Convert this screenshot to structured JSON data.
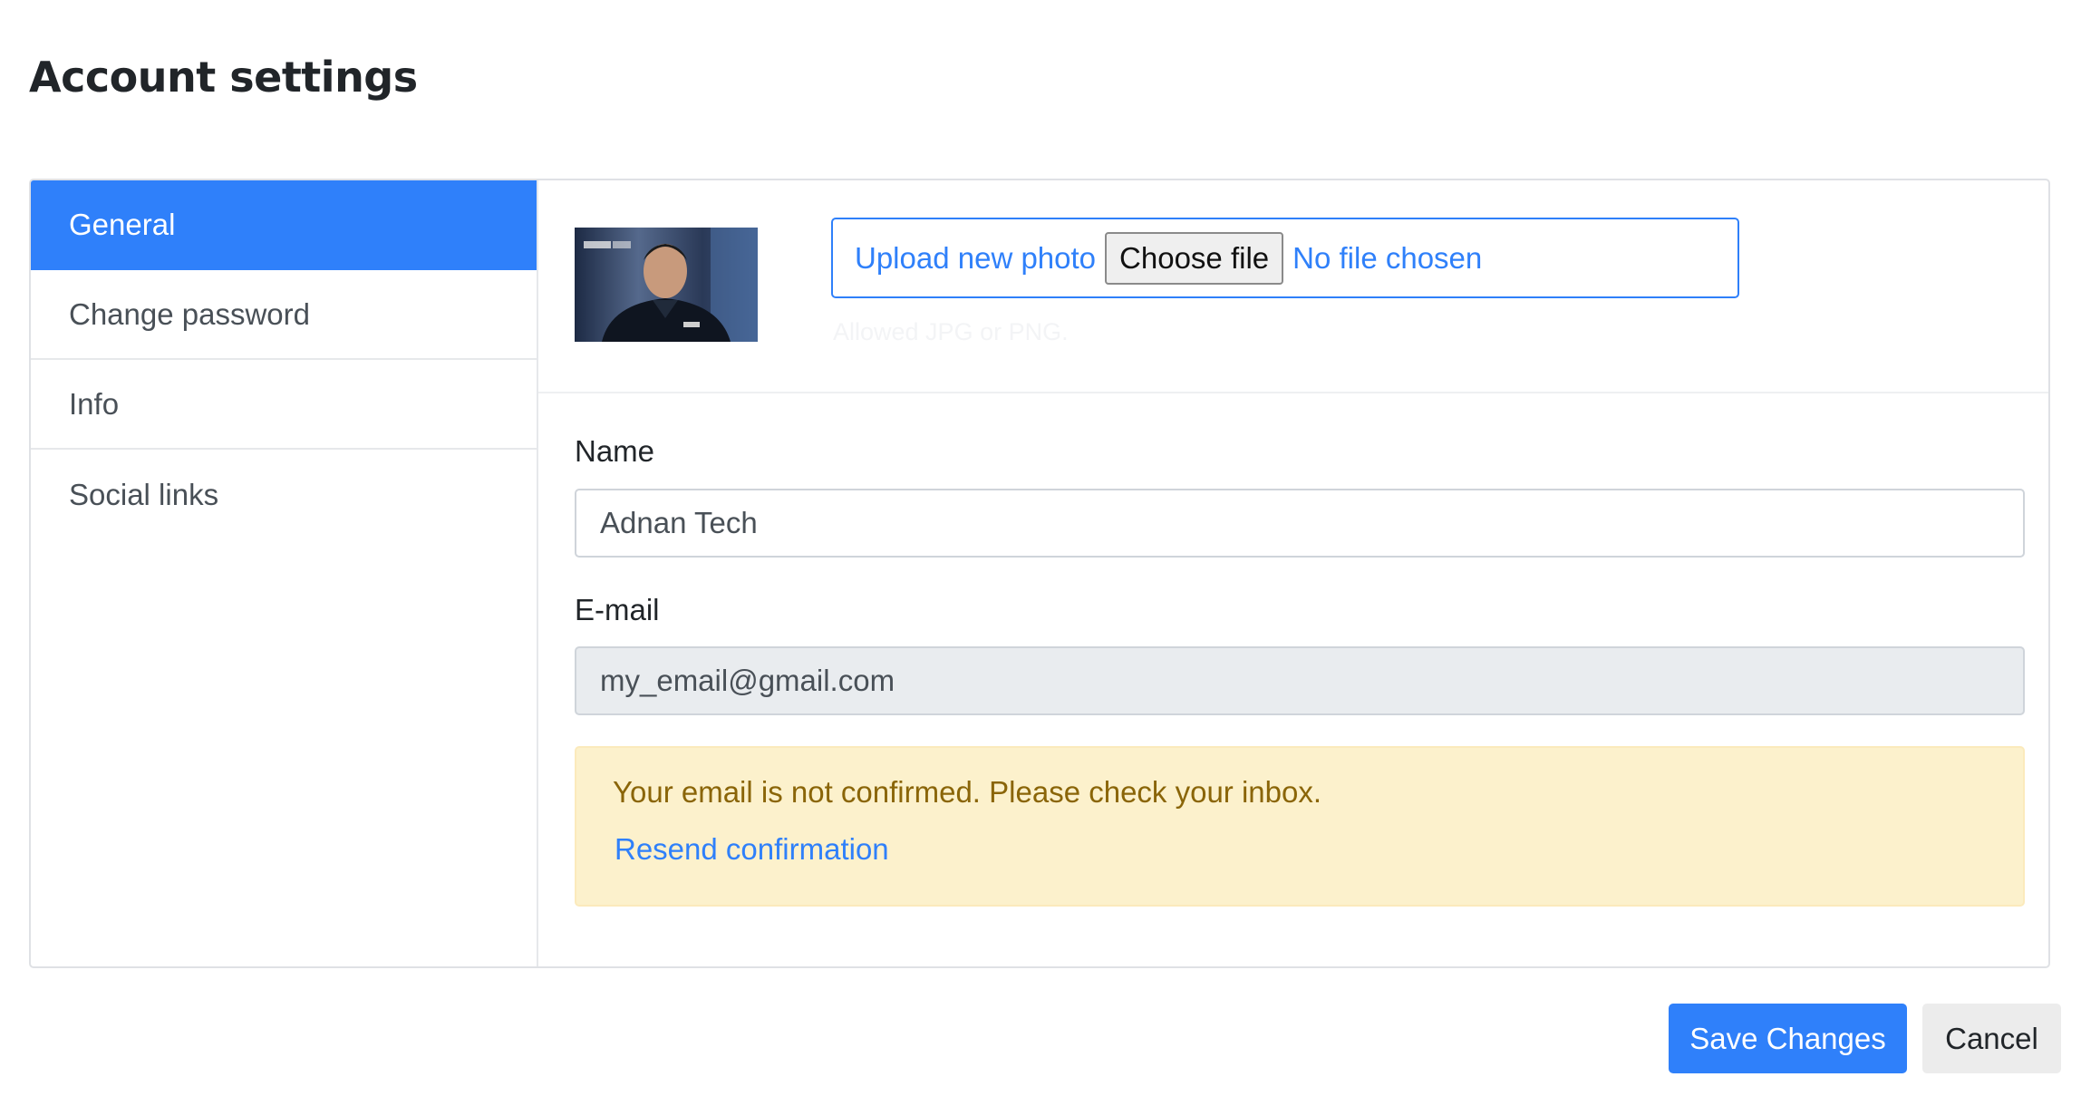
{
  "page": {
    "title": "Account settings"
  },
  "sidebar": {
    "items": [
      {
        "label": "General",
        "active": true
      },
      {
        "label": "Change password",
        "active": false
      },
      {
        "label": "Info",
        "active": false
      },
      {
        "label": "Social links",
        "active": false
      }
    ]
  },
  "photo": {
    "upload_label": "Upload new photo",
    "choose_file_label": "Choose file",
    "file_status": "No file chosen",
    "allowed_note": "Allowed JPG or PNG."
  },
  "form": {
    "name_label": "Name",
    "name_value": "Adnan Tech",
    "email_label": "E-mail",
    "email_value": "my_email@gmail.com"
  },
  "alert": {
    "message": "Your email is not confirmed. Please check your inbox.",
    "link_label": "Resend confirmation"
  },
  "actions": {
    "save_label": "Save Changes",
    "cancel_label": "Cancel"
  },
  "colors": {
    "accent": "#2f80fa",
    "alert_background": "#fcf1cc",
    "alert_text": "#8a6508",
    "readonly_input": "#e9ecef"
  }
}
